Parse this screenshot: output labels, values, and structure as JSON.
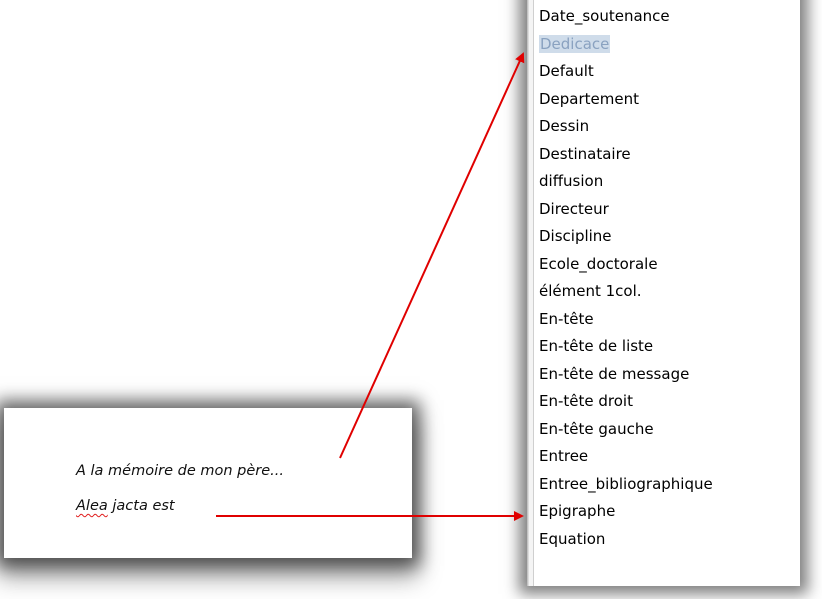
{
  "document": {
    "lines": [
      {
        "text": "A la mémoire de mon père..."
      },
      {
        "misspelled": "Alea",
        "rest": " jacta est"
      }
    ]
  },
  "style_list": {
    "selected_index": 1,
    "items": [
      "Date_soutenance",
      "Dedicace",
      "Default",
      "Departement",
      "Dessin",
      "Destinataire",
      "diffusion",
      "Directeur",
      "Discipline",
      "Ecole_doctorale",
      "élément 1col.",
      "En-tête",
      "En-tête de liste",
      "En-tête de message",
      "En-tête droit",
      "En-tête gauche",
      "Entree",
      "Entree_bibliographique",
      "Epigraphe",
      "Equation"
    ]
  },
  "colors": {
    "arrow": "#e00000",
    "selection_bg": "#cfdcea",
    "spellcheck": "#e01b1b"
  }
}
